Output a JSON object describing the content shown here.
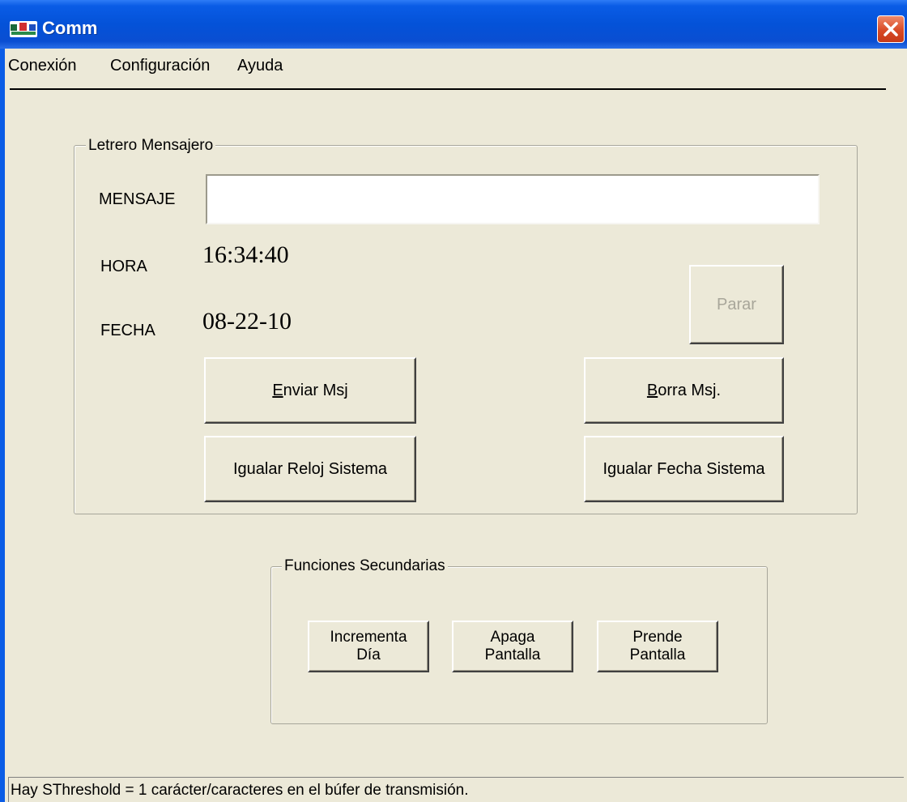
{
  "window": {
    "title": "Comm"
  },
  "menu": {
    "items": [
      "Conexión",
      "Configuración",
      "Ayuda"
    ]
  },
  "group_main": {
    "label": "Letrero Mensajero",
    "mensaje_label": "MENSAJE",
    "mensaje_value": "",
    "hora_label": "HORA",
    "hora_value": "16:34:40",
    "fecha_label": "FECHA",
    "fecha_value": "08-22-10",
    "buttons": {
      "parar": "Parar",
      "enviar_first": "E",
      "enviar_rest": "nviar Msj",
      "borra_first": "B",
      "borra_rest": "orra Msj.",
      "igualar_reloj": "Igualar Reloj Sistema",
      "igualar_fecha": "Igualar Fecha Sistema"
    }
  },
  "group_secondary": {
    "label": "Funciones Secundarias",
    "buttons": {
      "incrementa": "Incrementa\nDía",
      "apaga": "Apaga\nPantalla",
      "prende": "Prende\nPantalla"
    }
  },
  "status": {
    "text": "Hay SThreshold = 1 carácter/caracteres en el búfer de transmisión."
  },
  "colors": {
    "titlebar": "#0452d8",
    "window_bg": "#ece9d8",
    "close_button": "#d84a26",
    "disabled_text": "#a8a69a"
  }
}
